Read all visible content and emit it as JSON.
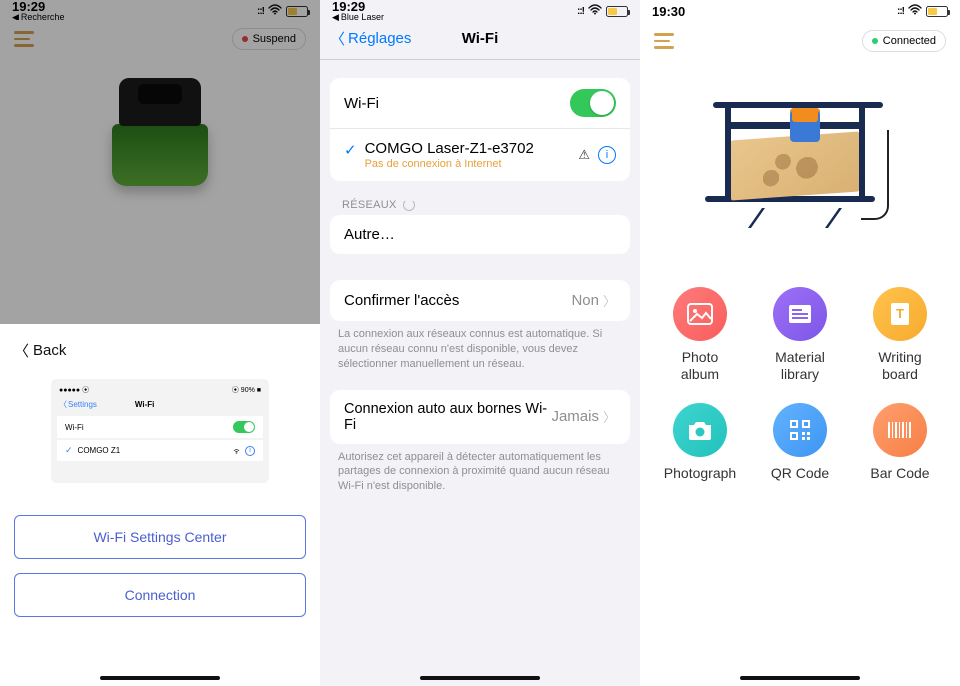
{
  "screen1": {
    "status": {
      "time": "19:29",
      "back": "Recherche"
    },
    "header": {
      "suspend_label": "Suspend"
    },
    "sheet": {
      "back_label": "Back",
      "preview": {
        "settings_link": "Settings",
        "title": "Wi-Fi",
        "wifi_label": "Wi-Fi",
        "network_name": "COMGO Z1"
      },
      "btn_wifi_center": "Wi-Fi Settings Center",
      "btn_connection": "Connection"
    }
  },
  "screen2": {
    "status": {
      "time": "19:29",
      "back": "Blue Laser"
    },
    "nav": {
      "back": "Réglages",
      "title": "Wi-Fi"
    },
    "wifi_row": {
      "label": "Wi-Fi"
    },
    "network": {
      "name": "COMGO Laser-Z1-e3702",
      "sub": "Pas de connexion à Internet"
    },
    "networks_header": "RÉSEAUX",
    "other_label": "Autre…",
    "confirm": {
      "label": "Confirmer l'accès",
      "value": "Non"
    },
    "confirm_footer": "La connexion aux réseaux connus est automatique. Si aucun réseau connu n'est disponible, vous devez sélectionner manuellement un réseau.",
    "auto": {
      "label": "Connexion auto aux bornes Wi-Fi",
      "value": "Jamais"
    },
    "auto_footer": "Autorisez cet appareil à détecter automatiquement les partages de connexion à proximité quand aucun réseau Wi-Fi n'est disponible."
  },
  "screen3": {
    "status": {
      "time": "19:30"
    },
    "header": {
      "connected_label": "Connected"
    },
    "menu": {
      "items": [
        {
          "label": "Photo album"
        },
        {
          "label": "Material library"
        },
        {
          "label": "Writing board"
        },
        {
          "label": "Photograph"
        },
        {
          "label": "QR Code"
        },
        {
          "label": "Bar Code"
        }
      ]
    }
  }
}
